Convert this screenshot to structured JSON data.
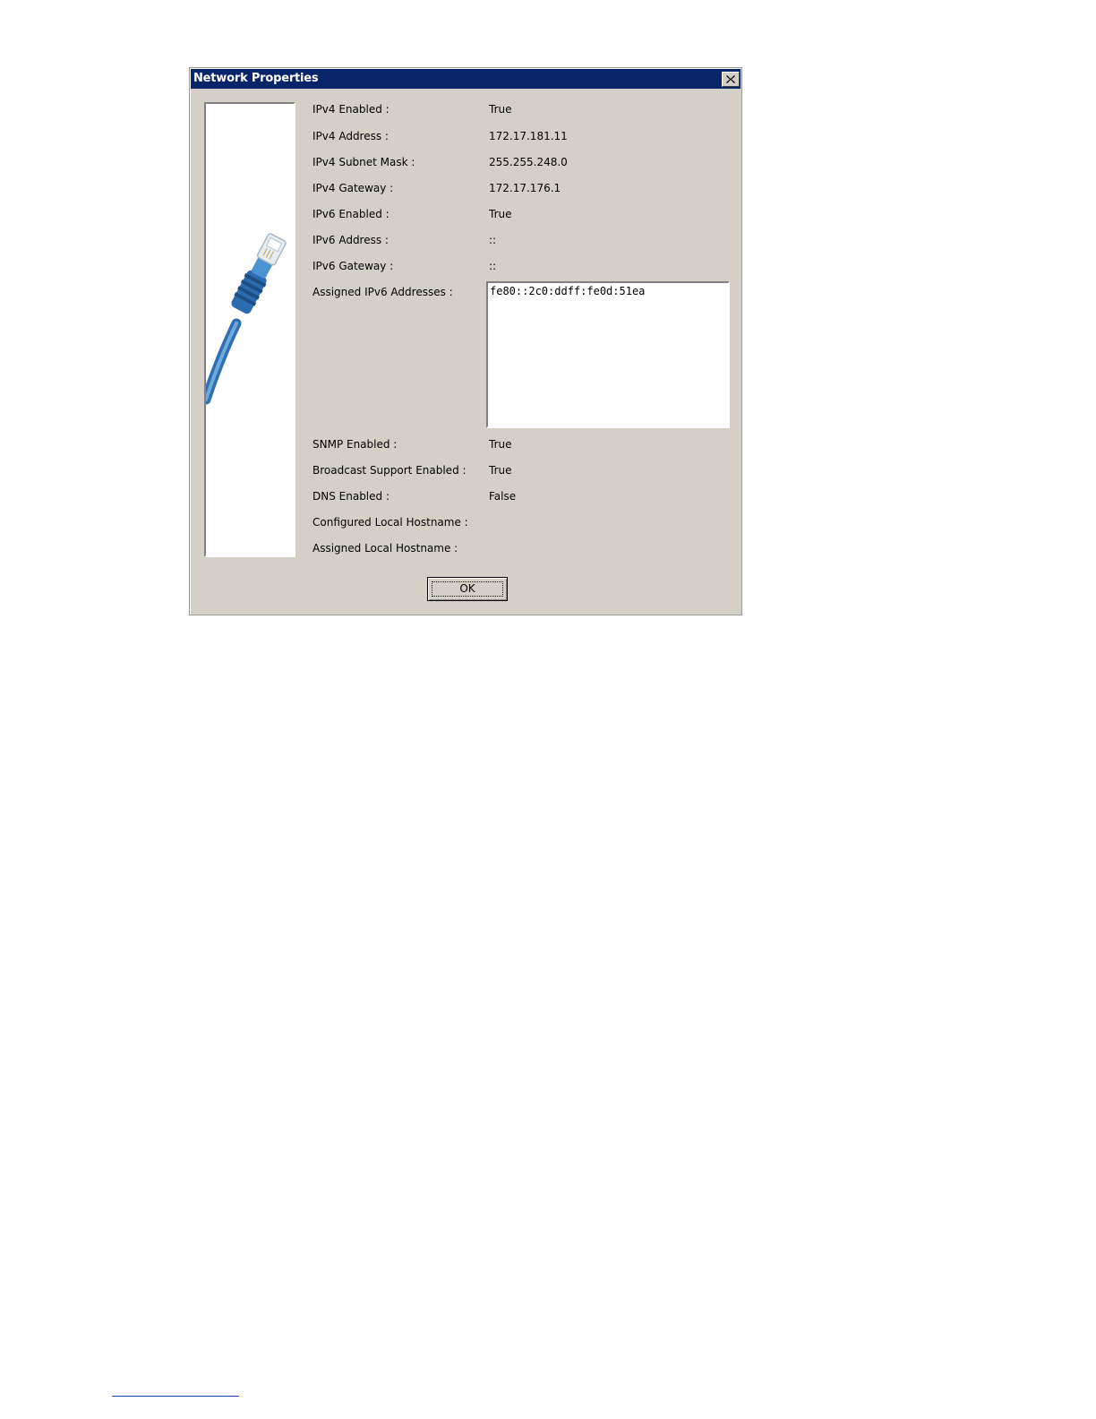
{
  "dialog": {
    "title": "Network Properties",
    "close_icon": "close-x-icon",
    "image_icon": "ethernet-cable-icon",
    "fields": [
      {
        "label": "IPv4 Enabled :",
        "value": "True"
      },
      {
        "label": "IPv4 Address :",
        "value": "172.17.181.11"
      },
      {
        "label": "IPv4 Subnet Mask :",
        "value": "255.255.248.0"
      },
      {
        "label": "IPv4 Gateway :",
        "value": "172.17.176.1"
      },
      {
        "label": "IPv6 Enabled :",
        "value": "True"
      },
      {
        "label": "IPv6 Address :",
        "value": "::"
      },
      {
        "label": "IPv6 Gateway :",
        "value": "::"
      }
    ],
    "assigned_ipv6": {
      "label": "Assigned IPv6 Addresses :",
      "items": [
        "fe80::2c0:ddff:fe0d:51ea"
      ]
    },
    "fields_lower": [
      {
        "label": "SNMP Enabled :",
        "value": "True"
      },
      {
        "label": "Broadcast Support Enabled :",
        "value": "True"
      },
      {
        "label": "DNS Enabled :",
        "value": "False"
      },
      {
        "label": "Configured Local Hostname :",
        "value": ""
      },
      {
        "label": "Assigned Local Hostname :",
        "value": ""
      }
    ],
    "ok_label": "OK"
  },
  "colors": {
    "titlebar": "#0a246a",
    "dialog_bg": "#d4d0c8",
    "cable_blue": "#3f86c8"
  }
}
